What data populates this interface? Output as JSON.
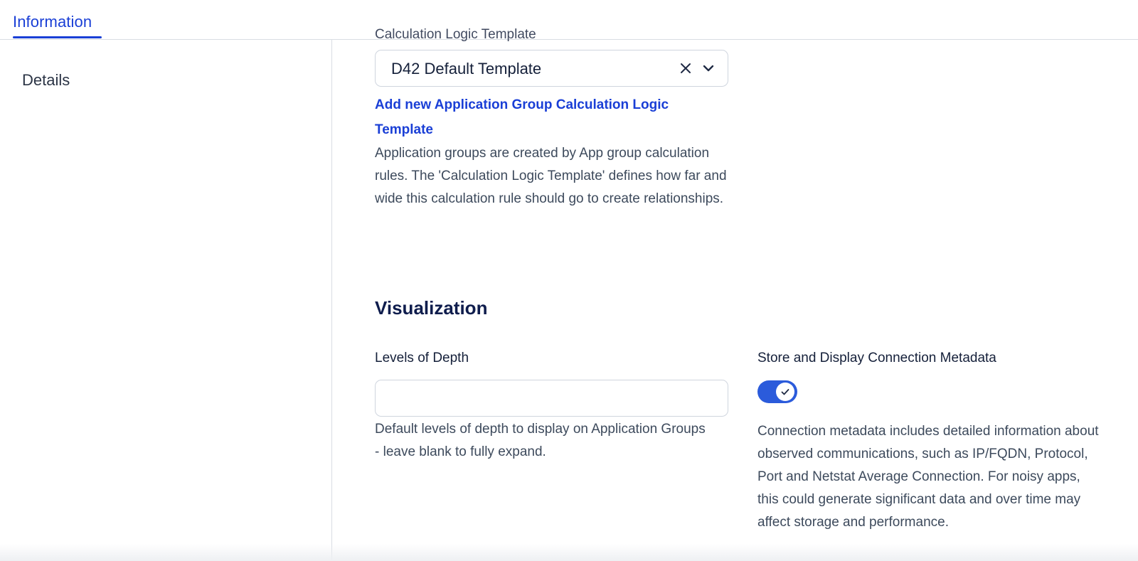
{
  "tabs": [
    {
      "label": "Information",
      "active": true
    }
  ],
  "sidebar": {
    "items": [
      {
        "label": "Details"
      }
    ]
  },
  "calc_logic": {
    "cutoff_label": "Calculation Logic Template",
    "selected_value": "D42 Default Template",
    "add_link": "Add new Application Group Calculation Logic Template",
    "help": "Application groups are created by App group calculation rules. The 'Calculation Logic Template' defines how far and wide this calculation rule should go to create relationships."
  },
  "visualization": {
    "title": "Visualization",
    "depth": {
      "label": "Levels of Depth",
      "value": "",
      "placeholder": "",
      "help": "Default levels of depth to display on Application Groups - leave blank to fully expand."
    },
    "metadata": {
      "label": "Store and Display Connection Metadata",
      "enabled": true,
      "help": "Connection metadata includes detailed information about observed communications, such as IP/FQDN, Protocol, Port and Netstat Average Connection. For noisy apps, this could generate significant data and over time may affect storage and performance."
    }
  },
  "colors": {
    "accent": "#1a3fd6",
    "toggle_on": "#2b5bdb",
    "heading": "#0f1d4d",
    "body_text": "#3d4a5c",
    "border": "#cfd5de"
  }
}
